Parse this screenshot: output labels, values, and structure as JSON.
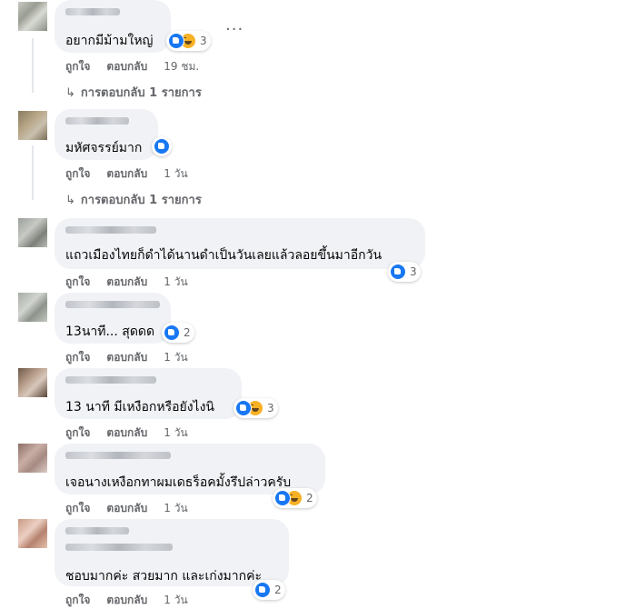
{
  "actions": {
    "like": "ถูกใจ",
    "reply": "ตอบกลับ"
  },
  "comments": [
    {
      "text": "อยากมีม้ามใหญ่",
      "reactions": [
        "like",
        "haha"
      ],
      "count": "3",
      "time": "19 ชม.",
      "replies": "การตอบกลับ 1 รายการ"
    },
    {
      "text": "มหัศจรรย์มาก",
      "reactions": [
        "like"
      ],
      "count": "",
      "time": "1 วัน",
      "replies": "การตอบกลับ 1 รายการ"
    },
    {
      "text": "แถวเมืองไทยก็ดำได้นานดำเป็นวันเลยแล้วลอยขึ้นมาอีกวัน",
      "reactions": [
        "like"
      ],
      "count": "3",
      "time": "1 วัน"
    },
    {
      "text": "13นาที... สุดดด",
      "reactions": [
        "like"
      ],
      "count": "2",
      "time": "1 วัน"
    },
    {
      "text": "13 นาที มีเหงือกหรือยังไงนิ",
      "reactions": [
        "like",
        "haha"
      ],
      "count": "3",
      "time": "1 วัน"
    },
    {
      "text": "เจอนางเหงือกทาผมเดธร็อคมั้งรึปล่าวครับ",
      "reactions": [
        "like",
        "haha"
      ],
      "count": "2",
      "time": "1 วัน"
    },
    {
      "text": "ชอบมากค่ะ สวยมาก และเก่งมากค่ะ",
      "reactions": [
        "like"
      ],
      "count": "2",
      "time": "1 วัน"
    }
  ],
  "more_label": "···",
  "colors": {
    "bubble": "#f0f2f5",
    "meta": "#65676b",
    "like": "#1877f2",
    "haha": "#f7b125"
  }
}
